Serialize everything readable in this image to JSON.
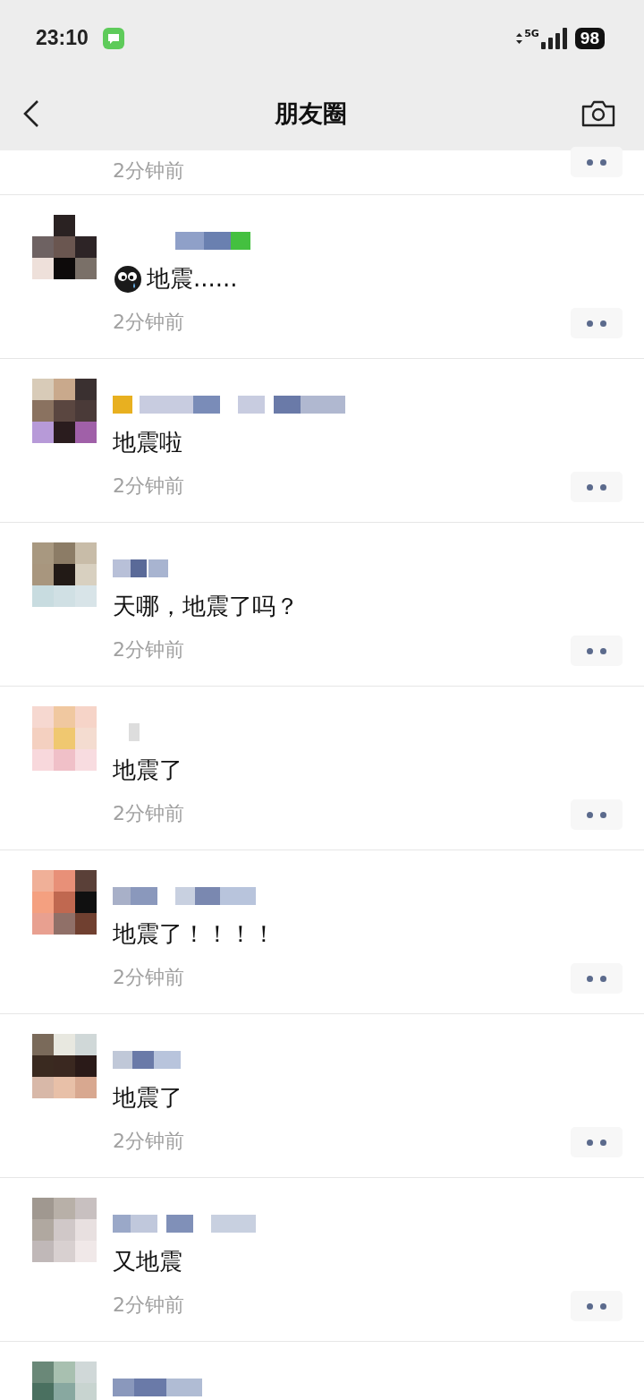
{
  "status_bar": {
    "time": "23:10",
    "network": "5G",
    "battery": "98"
  },
  "nav": {
    "title": "朋友圈"
  },
  "posts": [
    {
      "kind": "tail",
      "time": "2分钟前"
    },
    {
      "kind": "full",
      "emoji_prefix": true,
      "text": "地震......",
      "time": "2分钟前"
    },
    {
      "kind": "full",
      "emoji_prefix": false,
      "text": "地震啦",
      "time": "2分钟前"
    },
    {
      "kind": "full",
      "emoji_prefix": false,
      "text": "天哪，地震了吗？",
      "time": "2分钟前"
    },
    {
      "kind": "full",
      "emoji_prefix": false,
      "text": "地震了",
      "time": "2分钟前"
    },
    {
      "kind": "full",
      "emoji_prefix": false,
      "text": "地震了！！！！",
      "time": "2分钟前"
    },
    {
      "kind": "full",
      "emoji_prefix": false,
      "text": "地震了",
      "time": "2分钟前"
    },
    {
      "kind": "full",
      "emoji_prefix": false,
      "text": "又地震",
      "time": "2分钟前"
    },
    {
      "kind": "head"
    }
  ]
}
